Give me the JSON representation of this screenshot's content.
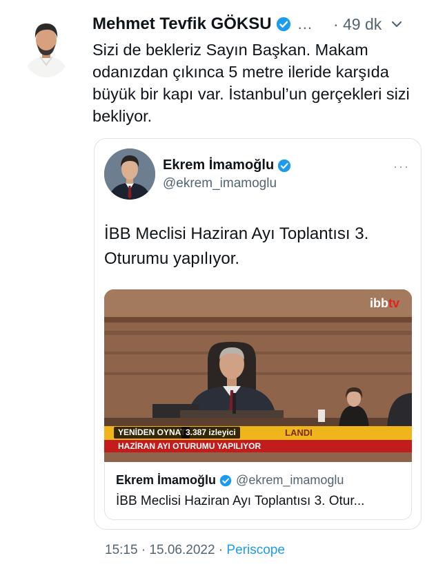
{
  "tweet": {
    "author_name": "Mehmet Tevfik GÖKSU",
    "more": "...",
    "time": "· 49 dk",
    "text": "Sizi de bekleriz Sayın Başkan. Makam odanızdan çıkınca 5 metre ileride karşıda büyük bir kapı var. İstanbul’un gerçekleri sizi bekliyor."
  },
  "quoted": {
    "name": "Ekrem İmamoğlu",
    "handle": "@ekrem_imamoglu",
    "more": "···",
    "text": "İBB Meclisi Haziran Ayı Toplantısı 3. Oturumu yapılıyor.",
    "media": {
      "logo_text": "ibb",
      "logo_suffix": "tv",
      "replay_label": "YENİDEN OYNAT",
      "viewers": "3.387 izleyici",
      "banner_fragment": "LANDI",
      "lower_third": "HAZİRAN AYI OTURUMU YAPILIYOR"
    },
    "link_card": {
      "name": "Ekrem İmamoğlu",
      "handle": "@ekrem_imamoglu",
      "title": "İBB Meclisi Haziran Ayı Toplantısı 3. Otur..."
    }
  },
  "footer": {
    "timestamp": "15:15 · 15.06.2022 · ",
    "source": "Periscope"
  },
  "colors": {
    "text": "#0f1419",
    "secondary": "#536471",
    "accent": "#1d9bf0",
    "border": "#dde3e8"
  },
  "icons": [
    "verified-badge-icon",
    "chevron-down-icon",
    "more-options-icon"
  ]
}
